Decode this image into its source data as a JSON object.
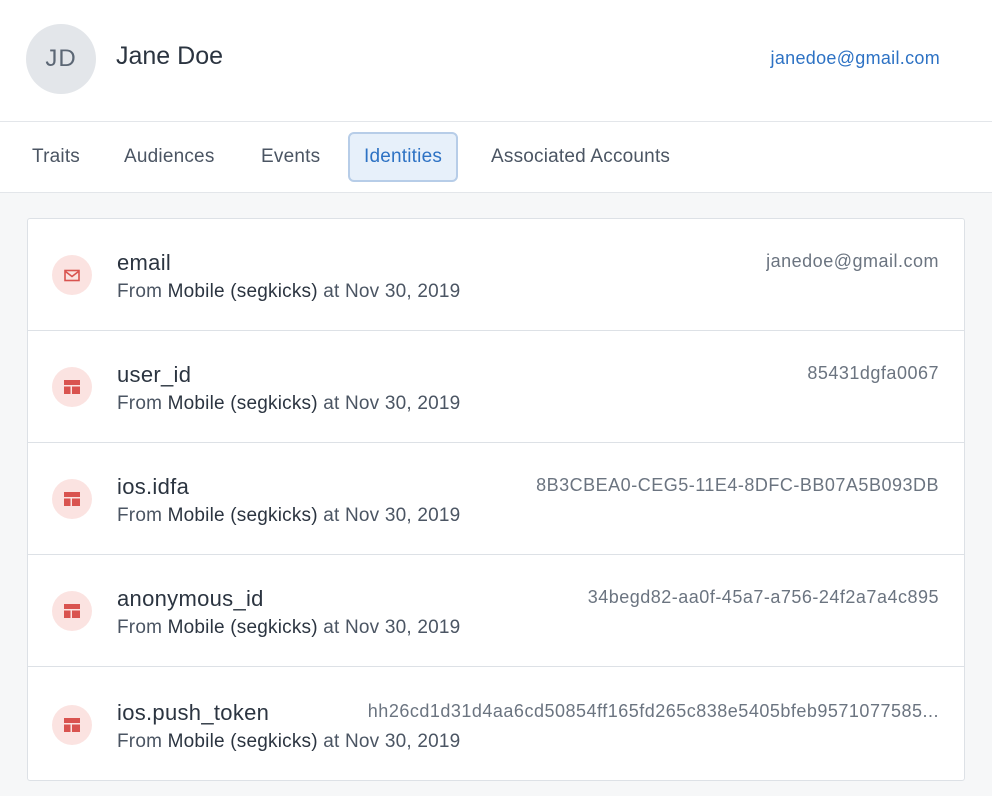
{
  "profile": {
    "initials": "JD",
    "name": "Jane Doe",
    "email": "janedoe@gmail.com"
  },
  "tabs": [
    {
      "label": "Traits"
    },
    {
      "label": "Audiences"
    },
    {
      "label": "Events"
    },
    {
      "label": "Identities",
      "active": true
    },
    {
      "label": "Associated Accounts"
    }
  ],
  "identities": [
    {
      "name": "email",
      "icon": "mail-icon",
      "from_prefix": "From ",
      "source": "Mobile (segkicks)",
      "at": " at Nov 30, 2019",
      "value": "janedoe@gmail.com"
    },
    {
      "name": "user_id",
      "icon": "table-icon",
      "from_prefix": "From ",
      "source": "Mobile (segkicks)",
      "at": " at Nov 30, 2019",
      "value": "85431dgfa0067"
    },
    {
      "name": "ios.idfa",
      "icon": "table-icon",
      "from_prefix": "From ",
      "source": "Mobile (segkicks)",
      "at": " at Nov 30, 2019",
      "value": "8B3CBEA0-CEG5-11E4-8DFC-BB07A5B093DB"
    },
    {
      "name": "anonymous_id",
      "icon": "table-icon",
      "from_prefix": "From ",
      "source": "Mobile (segkicks)",
      "at": " at Nov 30, 2019",
      "value": "34begd82-aa0f-45a7-a756-24f2a7a4c895"
    },
    {
      "name": "ios.push_token",
      "icon": "table-icon",
      "from_prefix": "From ",
      "source": "Mobile (segkicks)",
      "at": " at Nov 30, 2019",
      "value": "hh26cd1d31d4aa6cd50854ff165fd265c838e5405bfeb9571077585..."
    }
  ],
  "colors": {
    "accent": "#2d72c4",
    "icon_red": "#d9534f",
    "icon_bg": "#fbe3e1"
  }
}
